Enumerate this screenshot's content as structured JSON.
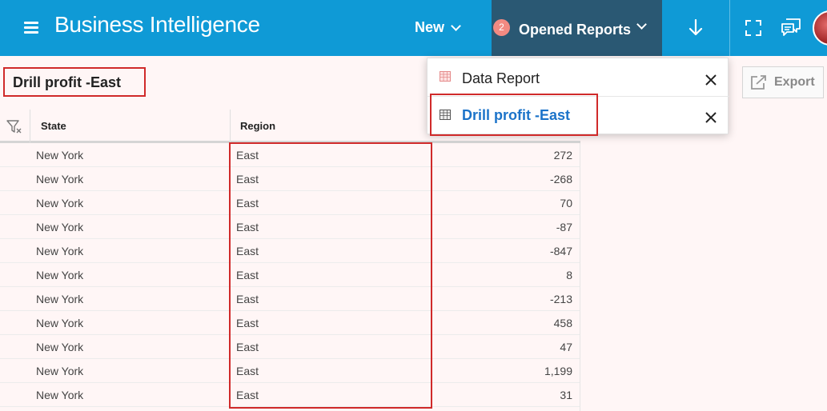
{
  "header": {
    "app_title": "Business Intelligence",
    "new_label": "New",
    "opened_reports_label": "Opened Reports",
    "opened_reports_count": "2",
    "menu_icon": "hamburger-menu-icon",
    "download_icon": "arrow-down-icon",
    "fullscreen_icon": "fullscreen-icon",
    "chat_icon": "chat-icon",
    "background_color": "#0f9ad6",
    "active_tab_color": "#2a5873"
  },
  "report": {
    "title": "Drill profit -East",
    "export_label": "Export"
  },
  "dropdown": {
    "items": [
      {
        "label": "Data Report",
        "icon": "report-grid-icon",
        "active": false
      },
      {
        "label": "Drill profit -East",
        "icon": "report-grid-icon",
        "active": true
      }
    ]
  },
  "table": {
    "columns": [
      "State",
      "Region"
    ],
    "rows": [
      {
        "state": "New York",
        "region": "East",
        "value": "272"
      },
      {
        "state": "New York",
        "region": "East",
        "value": "-268"
      },
      {
        "state": "New York",
        "region": "East",
        "value": "70"
      },
      {
        "state": "New York",
        "region": "East",
        "value": "-87"
      },
      {
        "state": "New York",
        "region": "East",
        "value": "-847"
      },
      {
        "state": "New York",
        "region": "East",
        "value": "8"
      },
      {
        "state": "New York",
        "region": "East",
        "value": "-213"
      },
      {
        "state": "New York",
        "region": "East",
        "value": "458"
      },
      {
        "state": "New York",
        "region": "East",
        "value": "47"
      },
      {
        "state": "New York",
        "region": "East",
        "value": "1,199"
      },
      {
        "state": "New York",
        "region": "East",
        "value": "31"
      }
    ]
  },
  "colors": {
    "highlight": "#d02a2a",
    "active_link": "#1b73c9",
    "badge": "#f28a82"
  }
}
